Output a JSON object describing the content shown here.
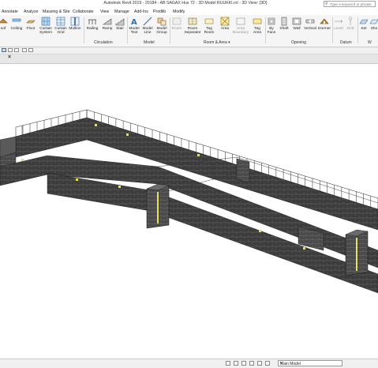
{
  "window": {
    "title": "Autodesk Revit 2019 - 20184 - AB SAGAX Hus 72 - 3D Model RUUKKI.rvt - 3D View: {3D}"
  },
  "search": {
    "placeholder": "Type a keyword or phrase"
  },
  "ribbon_tabs": [
    "Annotate",
    "Analyze",
    "Massing & Site",
    "Collaborate",
    "View",
    "Manage",
    "Add-Ins",
    "Prodlib",
    "Modify"
  ],
  "ribbon_buttons": {
    "roof": "oof",
    "ceiling": "Ceiling",
    "floor": "Floor",
    "curtain_system": "Curtain System",
    "curtain_grid": "Curtain Grid",
    "mullion": "Mullion",
    "railing": "Railing",
    "ramp": "Ramp",
    "stair": "Stair",
    "model_text": "Model Text",
    "model_line": "Model Line",
    "model_group": "Model Group",
    "room": "Room",
    "room_separator": "Room Separator",
    "tag_room": "Tag Room",
    "area": "Area",
    "area_boundary": "Area Boundary",
    "tag_area": "Tag Area",
    "by_face": "By Face",
    "shaft": "Shaft",
    "wall": "Wall",
    "vertical": "Vertical",
    "dormer": "Dormer",
    "level": "Level",
    "grid": "Grid",
    "set": "Set",
    "show": "Sho"
  },
  "panels": {
    "circulation": "Circulation",
    "model": "Model",
    "room_area": "Room & Area ▾",
    "opening": "Opening",
    "datum": "Datum",
    "work_plane": "W"
  },
  "view_tab": {
    "close_glyph": "×"
  },
  "statusbar": {
    "model": "Main Model"
  },
  "colors": {
    "accent": "#0b5aa8",
    "ribbon_bg": "#f5f5f5",
    "wall_dark": "#3a3a3a",
    "wall_mid": "#5b5b5b",
    "window_highlight": "#e8e060"
  }
}
